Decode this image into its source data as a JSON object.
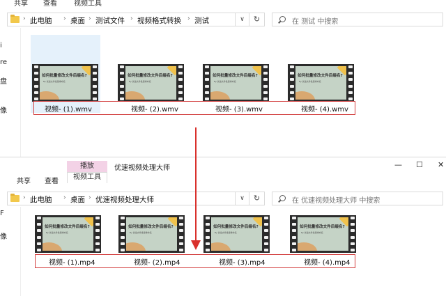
{
  "top_window": {
    "ribbon": {
      "share": "共享",
      "view": "查看",
      "video_tools": "视频工具"
    },
    "breadcrumb": [
      "此电脑",
      "桌面",
      "测试文件",
      "视频格式转换",
      "测试"
    ],
    "search_placeholder": "在 测试 中搜索",
    "nav_glyphs": [
      "i",
      "re",
      "盘",
      "像"
    ],
    "files": [
      {
        "name": "视频- (1).wmv",
        "slide_title": "如何批量修改文件后缀名?",
        "slide_sub": "By 优速文件批量重命名"
      },
      {
        "name": "视频- (2).wmv",
        "slide_title": "如何批量修改文件后缀名?",
        "slide_sub": "By 优速文件批量重命名"
      },
      {
        "name": "视频- (3).wmv",
        "slide_title": "如何批量修改文件后缀名?",
        "slide_sub": "By 优速文件批量重命名"
      },
      {
        "name": "视频- (4).wmv",
        "slide_title": "如何批量修改文件后缀名?",
        "slide_sub": "By 优速文件批量重命名"
      }
    ]
  },
  "bottom_window": {
    "title": "优速视频处理大师",
    "context_tab": "播放",
    "tool_tab": "视频工具",
    "menu": {
      "share": "共享",
      "view": "查看"
    },
    "controls": {
      "minimize": "—",
      "maximize": "☐",
      "close": "✕"
    },
    "breadcrumb": [
      "此电脑",
      "桌面",
      "优速视频处理大师"
    ],
    "search_placeholder": "在 优速视频处理大师 中搜索",
    "nav_glyphs": [
      "F",
      "像"
    ],
    "files": [
      {
        "name": "视频- (1).mp4",
        "slide_title": "如何批量修改文件后缀名?",
        "slide_sub": "By 优速文件批量重命名"
      },
      {
        "name": "视频- (2).mp4",
        "slide_title": "如何批量修改文件后缀名?",
        "slide_sub": "By 优速文件批量重命名"
      },
      {
        "name": "视频- (3).mp4",
        "slide_title": "如何批量修改文件后缀名?",
        "slide_sub": "By 优速文件批量重命名"
      },
      {
        "name": "视频- (4).mp4",
        "slide_title": "如何批量修改文件后缀名?",
        "slide_sub": "By 优速文件批量重命名"
      }
    ]
  },
  "colors": {
    "accent_red": "#d9302c",
    "selection": "#e5f1fb",
    "play_tab": "#f3d2e6",
    "folder": "#f2c84b"
  },
  "icons": {
    "refresh": "↻",
    "dropdown": "∨",
    "separator": "›"
  }
}
